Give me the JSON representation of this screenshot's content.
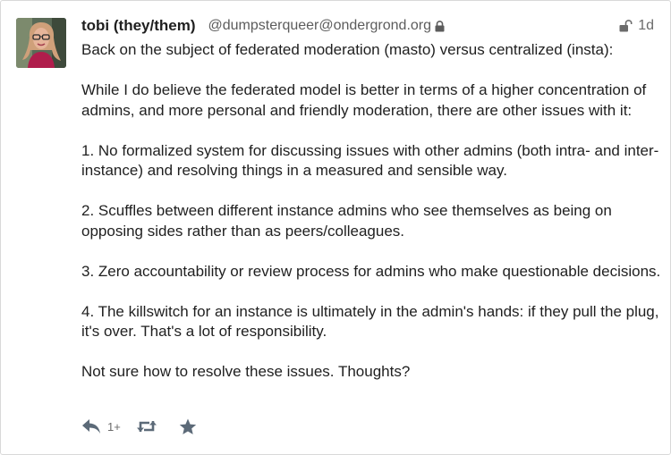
{
  "post": {
    "display_name": "tobi (they/them)",
    "account": "@dumpsterqueer@ondergrond.org",
    "time": "1d",
    "visibility_icon": "unlocked-padlock-icon",
    "account_lock_icon": "padlock-icon",
    "paragraphs": [
      "Back on the subject of federated moderation (masto) versus centralized (insta):",
      "While I do believe the federated model is better in terms of a higher concentration of admins, and more personal and friendly moderation, there are other issues with it:",
      "1. No formalized system for discussing issues with other admins (both intra- and inter-instance) and resolving things in a measured and sensible way.",
      "2. Scuffles between different instance admins who see themselves as being on opposing sides rather than as peers/colleagues.",
      "3. Zero accountability or review process for admins who make questionable decisions.",
      "4. The killswitch for an instance is ultimately in the admin's hands: if they pull the plug, it's over. That's a lot of responsibility.",
      "Not sure how to resolve these issues. Thoughts?"
    ],
    "actions": {
      "reply_icon": "reply-icon",
      "reply_count": "1+",
      "boost_icon": "boost-icon",
      "favourite_icon": "star-icon"
    }
  },
  "colors": {
    "text": "#1f1f1f",
    "muted": "#6b6b6b",
    "icon": "#5c6a78",
    "border": "#d9d9d9"
  }
}
